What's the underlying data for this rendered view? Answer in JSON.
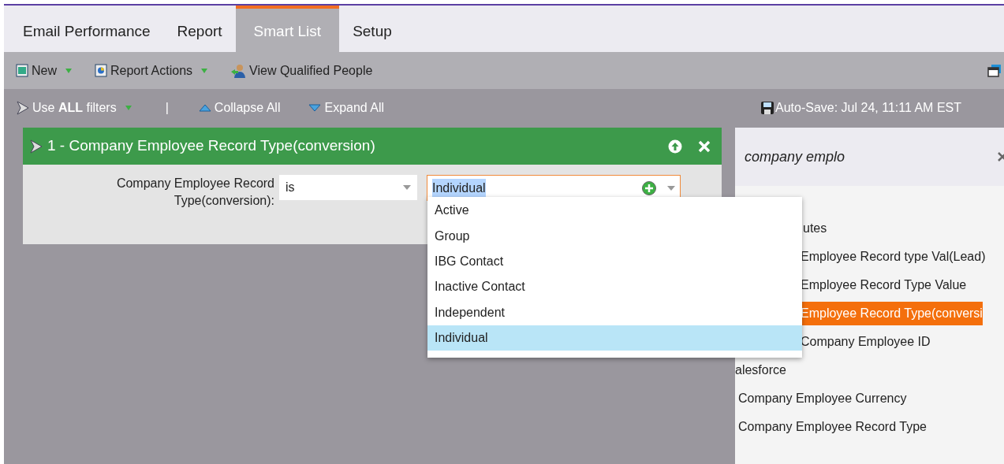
{
  "tabs": [
    {
      "label": "Email Performance",
      "selected": false
    },
    {
      "label": "Report",
      "selected": false
    },
    {
      "label": "Smart List",
      "selected": true
    },
    {
      "label": "Setup",
      "selected": false
    }
  ],
  "toolbar": [
    {
      "label": "New",
      "kind": "new",
      "menu": true
    },
    {
      "label": "Report Actions",
      "kind": "report",
      "menu": true
    },
    {
      "label": "View Qualified People",
      "kind": "people",
      "menu": false
    }
  ],
  "filter_bar": {
    "use_filters": "Use **ALL** filters",
    "separator": "|",
    "collapse": "Collapse All",
    "expand": "Expand All",
    "autosave": "Auto-Save: Jul 24, 11:11 AM EST"
  },
  "filter": {
    "title": "1 - Company Employee Record Type(conversion)",
    "label": "Company Employee Record Type(conversion):",
    "operator": "is",
    "value": "Individual",
    "options": [
      {
        "label": "Active",
        "selected": false
      },
      {
        "label": "Group",
        "selected": false
      },
      {
        "label": "IBG Contact",
        "selected": false
      },
      {
        "label": "Inactive Contact",
        "selected": false
      },
      {
        "label": "Independent",
        "selected": false
      },
      {
        "label": "Individual",
        "selected": true
      }
    ]
  },
  "side_panel": {
    "search": "company emplo",
    "groups": [
      {
        "label": "utes",
        "children": [
          {
            "label": "Employee Record type Val(Lead)",
            "selected": false
          },
          {
            "label": "Employee Record Type Value",
            "selected": false
          },
          {
            "label": "Employee Record Type(conversi",
            "selected": true
          },
          {
            "label": "Company Employee ID",
            "selected": false
          }
        ]
      },
      {
        "label": "alesforce",
        "children": [
          {
            "label": "Company Employee Currency",
            "selected": false
          },
          {
            "label": "Company Employee Record Type",
            "selected": false
          }
        ]
      }
    ]
  }
}
